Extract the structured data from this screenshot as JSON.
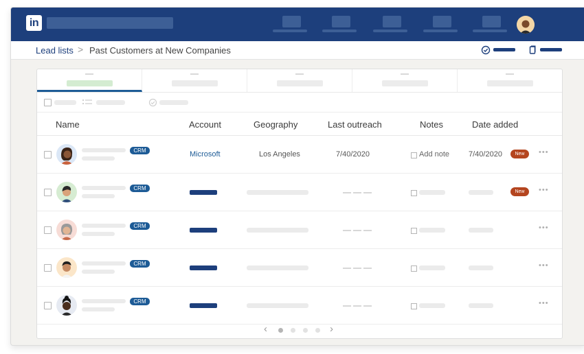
{
  "nav": {
    "logo": "in",
    "items": [
      "home",
      "network",
      "jobs",
      "messaging",
      "notifications"
    ]
  },
  "breadcrumb": {
    "parent": "Lead lists",
    "separator": ">",
    "current": "Past Customers at New Companies"
  },
  "table": {
    "columns": [
      "Name",
      "Account",
      "Geography",
      "Last outreach",
      "Notes",
      "Date added"
    ],
    "rows": [
      {
        "crm": "CRM",
        "account": "Microsoft",
        "geography": "Los Angeles",
        "last_outreach": "7/40/2020",
        "notes": "Add note",
        "date_added": "7/40/2020",
        "badge": "New"
      },
      {
        "crm": "CRM",
        "badge": "New"
      },
      {
        "crm": "CRM"
      },
      {
        "crm": "CRM"
      },
      {
        "crm": "CRM"
      }
    ]
  },
  "colors": {
    "brand": "#1d3f7c",
    "accent": "#1d5b96",
    "new_badge": "#b4451f"
  }
}
